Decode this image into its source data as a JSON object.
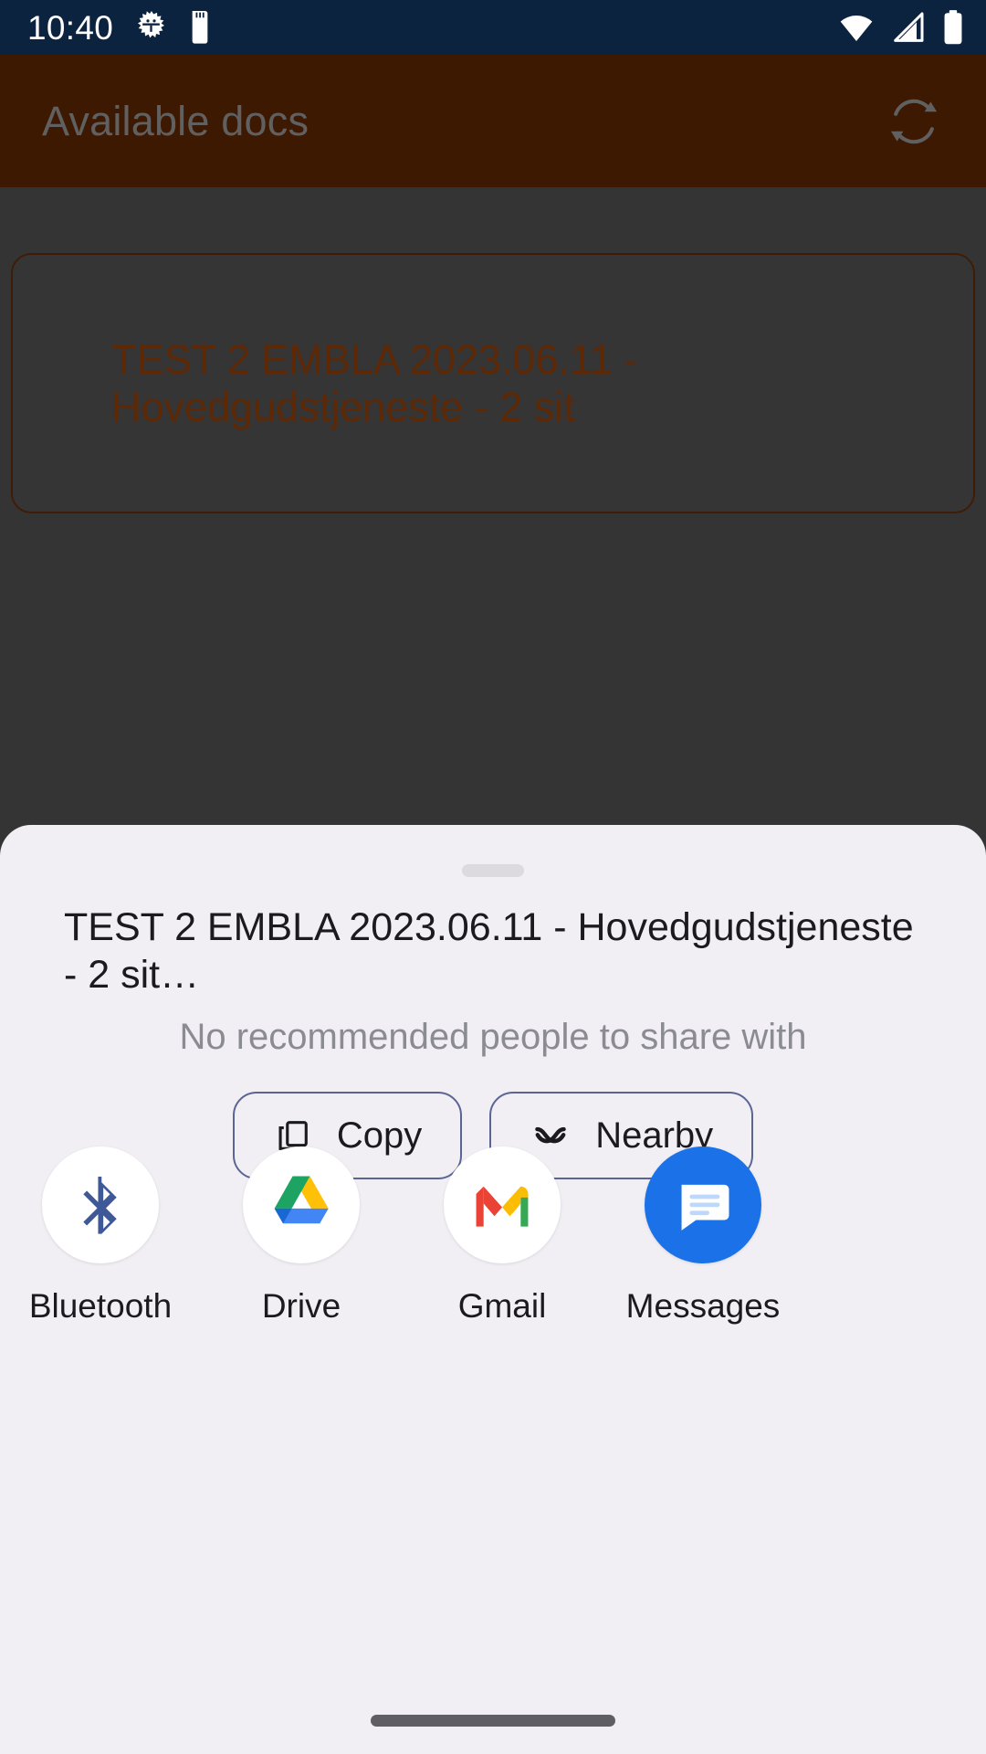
{
  "status_bar": {
    "clock": "10:40",
    "left_icons": [
      "bug-icon",
      "sd-card-icon"
    ],
    "right_icons": [
      "wifi-icon",
      "cellular-signal-icon",
      "battery-icon"
    ],
    "background_color": "#0c2340",
    "foreground_color": "#ffffff"
  },
  "app_bar": {
    "title": "Available docs",
    "action_icon": "sync-refresh-icon",
    "background_color": "#5a2503",
    "title_color": "#8e8e8e"
  },
  "content": {
    "cards": [
      {
        "title": "TEST 2 EMBLA 2023.06.11 - Hovedgudstjeneste - 2 sit"
      }
    ],
    "background_color": "#4d4d4d",
    "card_border_color": "#5d2a08",
    "card_text_color": "#8a3b08"
  },
  "share_sheet": {
    "drag_handle": "drag-handle",
    "title": "TEST 2 EMBLA 2023.06.11 - Hovedgudstjeneste - 2 sit…",
    "actions": [
      {
        "label": "Copy",
        "icon": "copy-icon"
      },
      {
        "label": "Nearby",
        "icon": "nearby-share-icon"
      }
    ],
    "empty_state": "No recommended people to share with",
    "apps": [
      {
        "label": "Bluetooth",
        "icon": "bluetooth-icon",
        "color": "#3f5897"
      },
      {
        "label": "Drive",
        "icon": "google-drive-icon",
        "color": "#1da462"
      },
      {
        "label": "Gmail",
        "icon": "gmail-icon",
        "color": "#ea4335"
      },
      {
        "label": "Messages",
        "icon": "google-messages-icon",
        "color": "#1b72e8"
      }
    ],
    "background_color": "#f1eff4",
    "chip_border_color": "#5a6595",
    "empty_state_color": "#8b8b92"
  },
  "navigation": {
    "gesture_pill": "home-gesture-pill"
  }
}
